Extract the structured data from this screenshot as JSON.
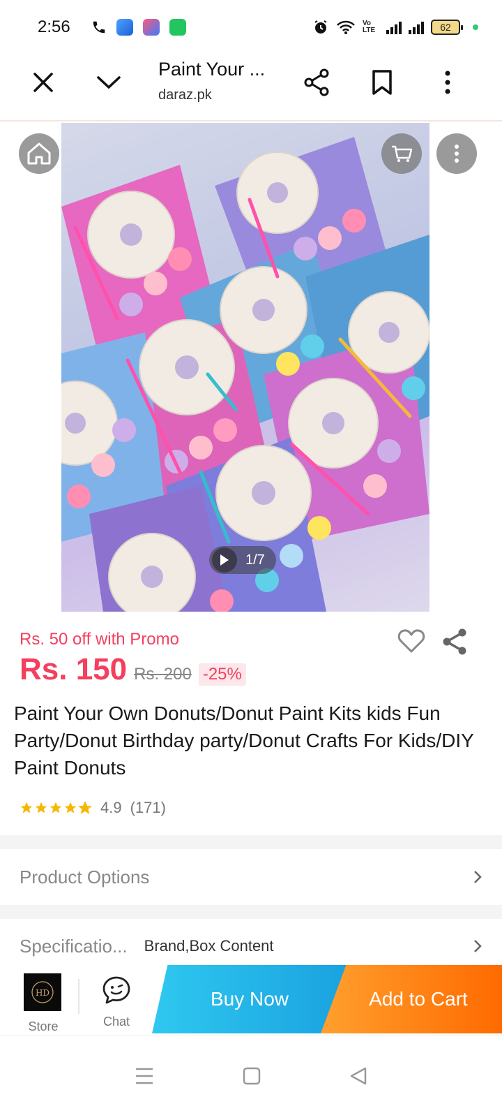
{
  "status_bar": {
    "time": "2:56",
    "volte_label": "Vo LTE",
    "battery": "62"
  },
  "browser": {
    "page_title": "Paint Your ...",
    "url": "daraz.pk"
  },
  "gallery": {
    "pager": "1/7"
  },
  "product": {
    "promo": "Rs. 50 off with Promo",
    "price": "Rs. 150",
    "old_price": "Rs. 200",
    "discount": "-25%",
    "name": "Paint Your Own Donuts/Donut Paint Kits kids Fun Party/Donut Birthday party/Donut Crafts For Kids/DIY Paint Donuts",
    "rating": "4.9",
    "rating_count": "(171)",
    "stars": 4.9
  },
  "rows": {
    "options_label": "Product Options",
    "spec_label": "Specificatio...",
    "spec_value": "Brand,Box Content"
  },
  "actions": {
    "store_label": "Store",
    "chat_label": "Chat",
    "buy_now": "Buy Now",
    "add_to_cart": "Add to Cart"
  },
  "colors": {
    "accent": "#f43f5e",
    "buy_now": "#1aa2e0",
    "add_to_cart": "#ff6a00"
  }
}
